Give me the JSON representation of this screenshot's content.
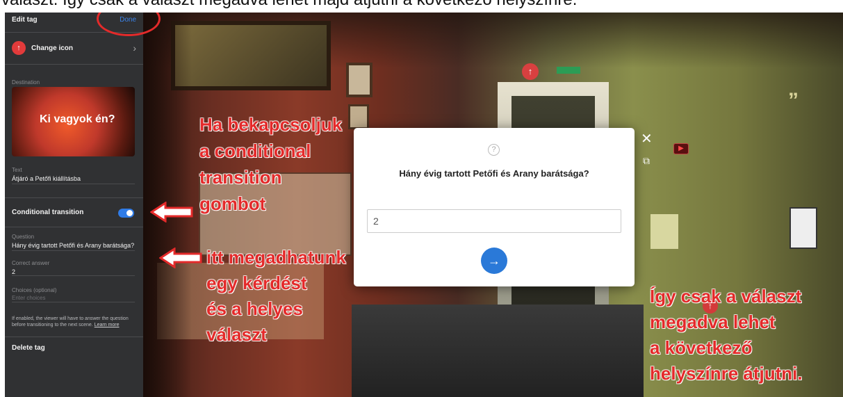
{
  "top_caption": "választ. Így csak a választ megadva lehet majd átjutni a következő helyszínre.",
  "sidebar": {
    "title": "Edit tag",
    "done_label": "Done",
    "change_icon_label": "Change icon",
    "change_icon_chevron": "›",
    "change_icon_glyph": "↑",
    "destination_caption": "Destination",
    "destination_thumb_title": "Ki vagyok én?",
    "text_caption": "Text",
    "text_value": "Átjáró a Petőfi kiállításba",
    "conditional_label": "Conditional transition",
    "conditional_enabled": true,
    "question_caption": "Question",
    "question_value": "Hány évig tartott Petőfi és Arany barátsága?",
    "answer_caption": "Correct answer",
    "answer_value": "2",
    "choices_caption": "Choices (optional)",
    "choices_placeholder": "Enter choices",
    "help_text": "If enabled, the viewer will have to answer the question before transitioning to the next scene.",
    "help_link": "Learn more",
    "delete_label": "Delete tag"
  },
  "modal": {
    "help_glyph": "?",
    "question": "Hány évig tartott Petőfi és Arany barátsága?",
    "answer_value": "2",
    "submit_glyph": "→"
  },
  "viewer": {
    "close_glyph": "✕",
    "vr_glyph": "⧉",
    "youtube_glyph": "▶",
    "marker_glyph": "↑",
    "quote_glyph": "”"
  },
  "annotations": {
    "left_block": [
      "Ha bekapcsoljuk",
      "a conditional",
      "transition",
      "gombot"
    ],
    "middle_block": [
      "itt megadhatunk",
      "egy kérdést",
      "és a helyes",
      "választ"
    ],
    "right_block": [
      "Így csak a választ",
      "megadva lehet",
      "a következő",
      "helyszínre átjutni."
    ]
  },
  "colors": {
    "accent_blue": "#2a79d8",
    "annotation_red": "#e42a2a",
    "sidebar_bg": "#303133",
    "icon_red": "#e23b3b"
  }
}
